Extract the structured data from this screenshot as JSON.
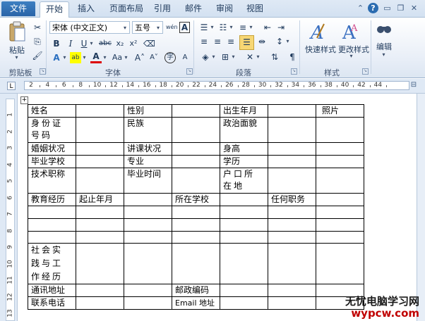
{
  "tabs": {
    "file": "文件",
    "items": [
      "开始",
      "插入",
      "页面布局",
      "引用",
      "邮件",
      "审阅",
      "视图"
    ]
  },
  "ribbon": {
    "clipboard": {
      "paste": "粘贴",
      "label": "剪贴板"
    },
    "font": {
      "name": "宋体 (中文正文)",
      "size": "五号",
      "label": "字体"
    },
    "paragraph": {
      "label": "段落"
    },
    "styles": {
      "quick": "快速样式",
      "change": "更改样式",
      "label": "样式"
    },
    "editing": {
      "label": "编辑"
    }
  },
  "ruler": {
    "marks": [
      "2",
      "4",
      "6",
      "8",
      "10",
      "12",
      "14",
      "16",
      "18",
      "20",
      "22",
      "24",
      "26",
      "28",
      "30",
      "32",
      "34",
      "36",
      "38",
      "40",
      "42",
      "44"
    ]
  },
  "vruler": {
    "marks": [
      "1",
      "2",
      "3",
      "4",
      "5",
      "6",
      "7",
      "8",
      "9",
      "10",
      "11",
      "12",
      "13"
    ]
  },
  "form": {
    "name": "姓名",
    "gender": "性别",
    "birth": "出生年月",
    "photo": "照片",
    "id_number": "身份证号码",
    "ethnicity": "民族",
    "politics": "政治面貌",
    "marital": "婚姻状况",
    "teaching": "讲课状况",
    "height": "身高",
    "school": "毕业学校",
    "major": "专业",
    "education": "学历",
    "title": "技术职称",
    "grad_time": "毕业时间",
    "hukou": "户口所在地",
    "edu_history": "教育经历",
    "start_end": "起止年月",
    "attended_school": "所在学校",
    "position": "任何职务",
    "experience": "社会实践与工作经历",
    "address": "通讯地址",
    "postcode": "邮政编码",
    "phone": "联系电话",
    "email": "Email 地址"
  },
  "watermark": {
    "cn": "无忧电脑学习网",
    "url": "wypcw.com"
  }
}
